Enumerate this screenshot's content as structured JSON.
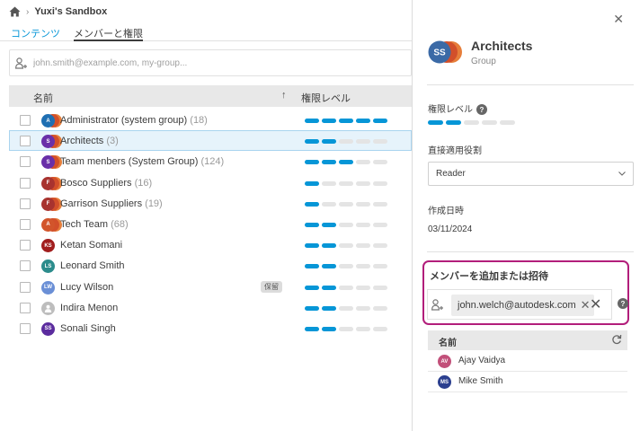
{
  "breadcrumb": {
    "title": "Yuxi's Sandbox"
  },
  "tabs": [
    {
      "label": "コンテンツ"
    },
    {
      "label": "メンバーと権限"
    }
  ],
  "search": {
    "placeholder": "john.smith@example.com, my-group..."
  },
  "table": {
    "col_name": "名前",
    "col_level": "権限レベル"
  },
  "colors": {
    "accent": "#0696d7",
    "highlight": "#b21e7b"
  },
  "rows": [
    {
      "name": "Administrator (system group)",
      "count": "(18)",
      "initials": "A",
      "color": "#1f6fb2",
      "group": true,
      "level": 5
    },
    {
      "name": "Architects",
      "count": "(3)",
      "initials": "S",
      "color": "#6a2fa8",
      "group": true,
      "level": 2,
      "selected": true
    },
    {
      "name": "Team menbers (System Group)",
      "count": "(124)",
      "initials": "S",
      "color": "#6a2fa8",
      "group": true,
      "level": 3
    },
    {
      "name": "Bosco Suppliers",
      "count": "(16)",
      "initials": "F",
      "color": "#a8332f",
      "group": true,
      "level": 1
    },
    {
      "name": "Garrison Suppliers",
      "count": "(19)",
      "initials": "F",
      "color": "#a8332f",
      "group": true,
      "level": 1
    },
    {
      "name": "Tech Team",
      "count": "(68)",
      "initials": "A",
      "color": "#d2552b",
      "group": true,
      "level": 2
    },
    {
      "name": "Ketan Somani",
      "count": "",
      "initials": "KS",
      "color": "#a11d1d",
      "group": false,
      "level": 2
    },
    {
      "name": "Leonard Smith",
      "count": "",
      "initials": "LS",
      "color": "#2c8c8c",
      "group": false,
      "level": 2
    },
    {
      "name": "Lucy Wilson",
      "count": "",
      "initials": "LW",
      "color": "#6a8fd6",
      "group": false,
      "level": 2,
      "badge": "保留"
    },
    {
      "name": "Indira Menon",
      "count": "",
      "initials": "",
      "color": "#bdbdbd",
      "group": false,
      "level": 2
    },
    {
      "name": "Sonali Singh",
      "count": "",
      "initials": "SS",
      "color": "#5b2c9e",
      "group": false,
      "level": 2
    }
  ],
  "panel": {
    "title": "Architects",
    "subtitle": "Group",
    "avatar_initials": "SS",
    "level_label": "権限レベル",
    "level": 2,
    "role_label": "直接適用役割",
    "role_value": "Reader",
    "created_label": "作成日時",
    "created_value": "03/11/2024",
    "invite_title": "メンバーを追加または招待",
    "invite_chip": "john.welch@autodesk.com",
    "members_header": "名前",
    "members": [
      {
        "name": "Ajay Vaidya",
        "initials": "AV",
        "color": "#c2507a"
      },
      {
        "name": "Mike Smith",
        "initials": "MS",
        "color": "#2b3f8f"
      }
    ]
  }
}
